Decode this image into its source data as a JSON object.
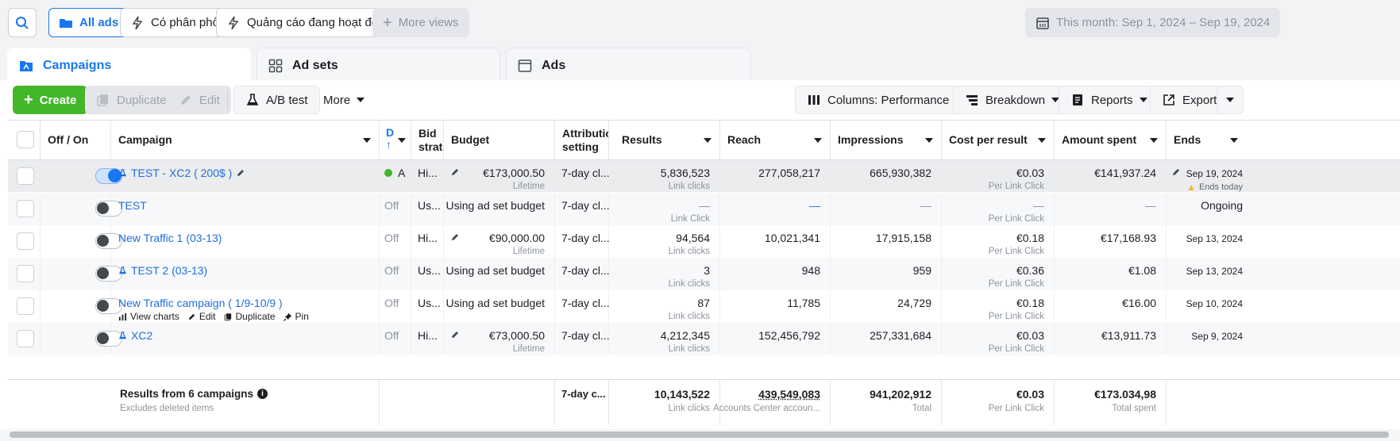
{
  "topbar": {
    "all_ads": "All ads",
    "views": [
      "Có phân phối",
      "Quảng cáo đang hoạt động"
    ],
    "more_views": "More views",
    "date_range": "This month: Sep 1, 2024 – Sep 19, 2024"
  },
  "tabs": [
    "Campaigns",
    "Ad sets",
    "Ads"
  ],
  "toolbar": {
    "create": "Create",
    "duplicate": "Duplicate",
    "edit": "Edit",
    "ab_test": "A/B test",
    "more": "More",
    "columns": "Columns: Performance",
    "breakdown": "Breakdown",
    "reports": "Reports",
    "export": "Export"
  },
  "columns": {
    "off_on": "Off / On",
    "campaign": "Campaign",
    "delivery": "D",
    "bid_strategy": "Bid strat",
    "budget": "Budget",
    "attribution": "Attributio setting",
    "results": "Results",
    "reach": "Reach",
    "impressions": "Impressions",
    "cost_per_result": "Cost per result",
    "amount_spent": "Amount spent",
    "ends": "Ends"
  },
  "rows": [
    {
      "name": "TEST - XC2 ( 200$ )",
      "on": true,
      "test": true,
      "delivery": "A",
      "active": true,
      "bid": "Hi...",
      "budget": "€173,000.50",
      "budget_sub": "Lifetime",
      "attribution": "7-day cl...",
      "results": "5,836,523",
      "results_sub": "Link clicks",
      "reach": "277,058,217",
      "impressions": "665,930,382",
      "cpr": "€0.03",
      "cpr_sub": "Per Link Click",
      "spent": "€141,937.24",
      "ends": "Sep 19, 2024",
      "ends_sub": "Ends today"
    },
    {
      "name": "TEST",
      "on": false,
      "test": false,
      "delivery": "Off",
      "active": false,
      "bid": "Us...",
      "budget": "Using ad set budget",
      "budget_sub": "",
      "attribution": "7-day cl...",
      "results": "—",
      "results_sub": "Link Click",
      "reach": "—",
      "impressions": "—",
      "cpr": "—",
      "cpr_sub": "Per Link Click",
      "spent": "—",
      "ends": "Ongoing",
      "ends_sub": ""
    },
    {
      "name": "New Traffic 1 (03-13)",
      "on": false,
      "test": false,
      "delivery": "Off",
      "active": false,
      "bid": "Hi...",
      "budget": "€90,000.00",
      "budget_sub": "Lifetime",
      "attribution": "7-day cl...",
      "results": "94,564",
      "results_sub": "Link clicks",
      "reach": "10,021,341",
      "impressions": "17,915,158",
      "cpr": "€0.18",
      "cpr_sub": "Per Link Click",
      "spent": "€17,168.93",
      "ends": "Sep 13, 2024",
      "ends_sub": ""
    },
    {
      "name": "TEST 2 (03-13)",
      "on": false,
      "test": true,
      "delivery": "Off",
      "active": false,
      "bid": "Us...",
      "budget": "Using ad set budget",
      "budget_sub": "",
      "attribution": "7-day cl...",
      "results": "3",
      "results_sub": "Link clicks",
      "reach": "948",
      "impressions": "959",
      "cpr": "€0.36",
      "cpr_sub": "Per Link Click",
      "spent": "€1.08",
      "ends": "Sep 13, 2024",
      "ends_sub": ""
    },
    {
      "name": "New Traffic campaign ( 1/9-10/9 )",
      "on": false,
      "test": false,
      "delivery": "Off",
      "active": false,
      "bid": "Us...",
      "budget": "Using ad set budget",
      "budget_sub": "",
      "attribution": "7-day cl...",
      "results": "87",
      "results_sub": "Link clicks",
      "reach": "11,785",
      "impressions": "24,729",
      "cpr": "€0.18",
      "cpr_sub": "Per Link Click",
      "spent": "€16.00",
      "ends": "Sep 10, 2024",
      "ends_sub": ""
    },
    {
      "name": "XC2",
      "on": false,
      "test": true,
      "delivery": "Off",
      "active": false,
      "bid": "Hi...",
      "budget": "€73,000.50",
      "budget_sub": "Lifetime",
      "attribution": "7-day cl...",
      "results": "4,212,345",
      "results_sub": "Link clicks",
      "reach": "152,456,792",
      "impressions": "257,331,684",
      "cpr": "€0.03",
      "cpr_sub": "Per Link Click",
      "spent": "€13,911.73",
      "ends": "Sep 9, 2024",
      "ends_sub": ""
    }
  ],
  "row_actions": [
    "View charts",
    "Edit",
    "Duplicate",
    "Pin"
  ],
  "summary": {
    "title": "Results from 6 campaigns",
    "subtitle": "Excludes deleted items",
    "attribution": "7-day c...",
    "results": "10,143,522",
    "results_sub": "Link clicks",
    "reach": "439,549,083",
    "reach_sub": "Accounts Center accoun...",
    "impressions": "941,202,912",
    "impressions_sub": "Total",
    "cpr": "€0.03",
    "cpr_sub": "Per Link Click",
    "spent": "€173.034,98",
    "spent_sub": "Total spent"
  },
  "colors": {
    "accent": "#1877f2",
    "create": "#42b72a",
    "active_dot": "#42b72a",
    "link": "#216fdb"
  }
}
